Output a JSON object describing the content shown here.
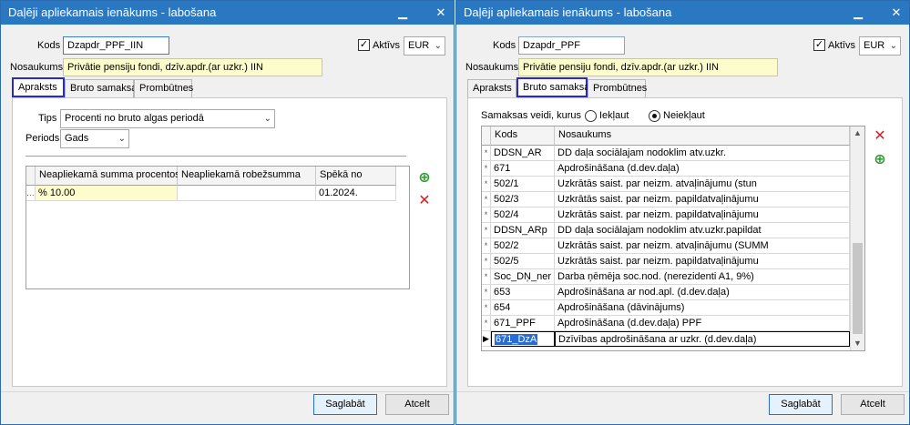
{
  "left": {
    "title": "Daļēji apliekamais ienākums - labošana",
    "kods_label": "Kods",
    "kods_value": "Dzapdr_PPF_IIN",
    "aktivs_label": "Aktīvs",
    "aktivs_checked": "✓",
    "currency": "EUR",
    "nosaukums_label": "Nosaukums",
    "nosaukums_value": "Privātie pensiju fondi, dzīv.apdr.(ar uzkr.) IIN",
    "tabs": [
      "Apraksts",
      "Bruto samaksa",
      "Prombūtnes"
    ],
    "tips_label": "Tips",
    "tips_value": "Procenti no bruto algas periodā",
    "periods_label": "Periods",
    "periods_value": "Gads",
    "grid_headers": [
      "Neapliekamā summa procentos",
      "Neapliekamā robežsumma",
      "Spēkā no"
    ],
    "grid_row": [
      "% 10.00",
      "",
      "01.2024."
    ],
    "save": "Saglabāt",
    "cancel": "Atcelt"
  },
  "right": {
    "title": "Daļēji apliekamais ienākums - labošana",
    "kods_label": "Kods",
    "kods_value": "Dzapdr_PPF",
    "aktivs_label": "Aktīvs",
    "aktivs_checked": "✓",
    "currency": "EUR",
    "nosaukums_label": "Nosaukums",
    "nosaukums_value": "Privātie pensiju fondi, dzīv.apdr.(ar uzkr.) IIN",
    "tabs": [
      "Apraksts",
      "Bruto samaksa",
      "Prombūtnes"
    ],
    "samaksas_label": "Samaksas veidi, kurus",
    "radio_include": "Iekļaut",
    "radio_exclude": "Neiekļaut",
    "grid_headers": [
      "Kods",
      "Nosaukums"
    ],
    "rows": [
      {
        "kods": "DDSN_AR",
        "nos": "DD daļa sociālajam nodoklim atv.uzkr."
      },
      {
        "kods": "671",
        "nos": "Apdrošināšana (d.dev.daļa)"
      },
      {
        "kods": "502/1",
        "nos": "Uzkrātās saist. par neizm. atvaļinājumu (stun"
      },
      {
        "kods": "502/3",
        "nos": "Uzkrātās saist. par neizm. papildatvaļinājumu"
      },
      {
        "kods": "502/4",
        "nos": "Uzkrātās saist. par neizm. papildatvaļinājumu"
      },
      {
        "kods": "DDSN_ARp",
        "nos": "DD daļa sociālajam nodoklim atv.uzkr.papildat"
      },
      {
        "kods": "502/2",
        "nos": "Uzkrātās saist. par neizm. atvaļinājumu (SUMM"
      },
      {
        "kods": "502/5",
        "nos": "Uzkrātās saist. par neizm. papildatvaļinājumu"
      },
      {
        "kods": "Soc_DŅ_ner",
        "nos": "Darba ņēmēja soc.nod. (nerezidenti A1, 9%)"
      },
      {
        "kods": "653",
        "nos": "Apdrošināšana ar nod.apl. (d.dev.daļa)"
      },
      {
        "kods": "654",
        "nos": "Apdrošināšana (dāvinājums)"
      },
      {
        "kods": "671_PPF",
        "nos": "Apdrošināšana  (d.dev.daļa) PPF"
      },
      {
        "kods": "671_DzA",
        "nos": "Dzīvības apdrošināšana ar uzkr. (d.dev.daļa)"
      }
    ],
    "save": "Saglabāt",
    "cancel": "Atcelt"
  }
}
